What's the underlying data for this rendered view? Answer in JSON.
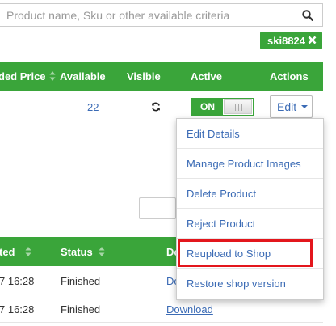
{
  "search": {
    "placeholder": "Product name, Sku or other available criteria",
    "value": "",
    "icon": "search-icon"
  },
  "filter_tag": {
    "label": "ski8824",
    "icon": "close-icon"
  },
  "products_table": {
    "columns": [
      "ded Price",
      "Available",
      "Visible",
      "Active",
      "Actions"
    ],
    "rows": [
      {
        "available": "22",
        "visible_icon": "sync-icon",
        "active_label": "ON",
        "action_label": "Edit"
      }
    ]
  },
  "actions_menu": {
    "items": [
      "Edit Details",
      "Manage Product Images",
      "Delete Product",
      "Reject Product",
      "Reupload to Shop",
      "Restore shop version"
    ],
    "highlighted": "Reupload to Shop",
    "highlight_color": "#e3161c"
  },
  "jobs_table": {
    "columns": [
      "ted",
      "Status",
      "Do"
    ],
    "rows": [
      {
        "date": "7 16:28",
        "status": "Finished",
        "download": "Do"
      },
      {
        "date": "7 16:28",
        "status": "Finished",
        "download": "Download"
      }
    ]
  },
  "colors": {
    "accent": "#3aa53a",
    "link": "#3b6bb5"
  }
}
